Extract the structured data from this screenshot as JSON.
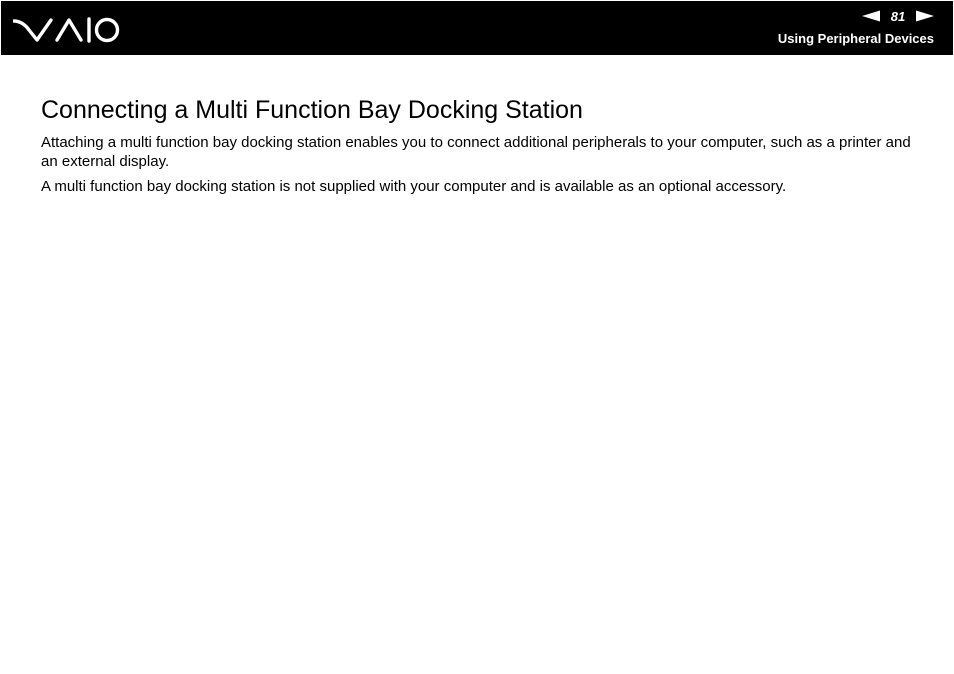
{
  "header": {
    "logo_text": "VAIO",
    "page_number": "81",
    "section_title": "Using Peripheral Devices",
    "prev_icon": "left-triangle-arrow",
    "next_icon": "right-triangle-arrow",
    "background": "#000000",
    "foreground": "#ffffff"
  },
  "main": {
    "title": "Connecting a Multi Function Bay Docking Station",
    "paragraphs": [
      "Attaching a multi function bay docking station enables you to connect additional peripherals to your computer, such as a printer and an external display.",
      "A multi function bay docking station is not supplied with your computer and is available as an optional accessory."
    ]
  }
}
